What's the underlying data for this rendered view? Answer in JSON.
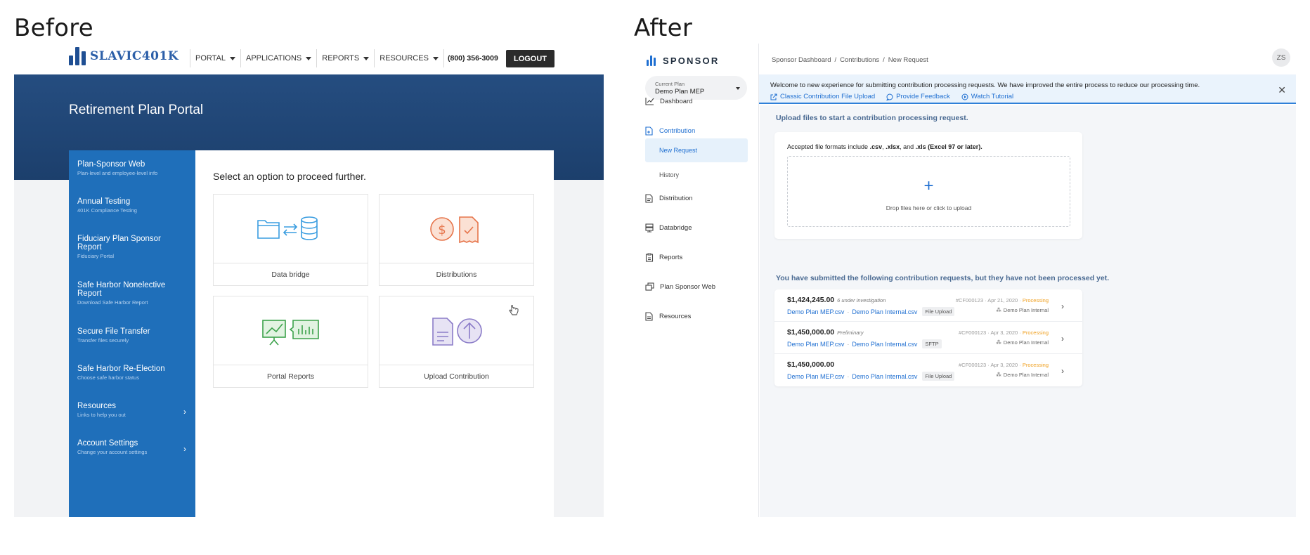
{
  "labels": {
    "before": "Before",
    "after": "After"
  },
  "before": {
    "logo": "SLAVIC401K",
    "nav": [
      "PORTAL",
      "APPLICATIONS",
      "REPORTS",
      "RESOURCES"
    ],
    "phone": "(800) 356-3009",
    "logout": "LOGOUT",
    "hero_title": "Retirement Plan Portal",
    "sidebar": [
      {
        "title": "Plan-Sponsor Web",
        "sub": "Plan-level and employee-level info"
      },
      {
        "title": "Annual Testing",
        "sub": "401K Compliance Testing"
      },
      {
        "title": "Fiduciary Plan Sponsor Report",
        "sub": "Fiduciary Portal"
      },
      {
        "title": "Safe Harbor Nonelective Report",
        "sub": "Download Safe Harbor Report"
      },
      {
        "title": "Secure File Transfer",
        "sub": "Transfer files securely"
      },
      {
        "title": "Safe Harbor Re-Election",
        "sub": "Choose safe harbor status"
      },
      {
        "title": "Resources",
        "sub": "Links to help you out"
      },
      {
        "title": "Account Settings",
        "sub": "Change your account settings"
      }
    ],
    "panel_title": "Select an option to proceed further.",
    "cards": [
      "Data bridge",
      "Distributions",
      "Portal Reports",
      "Upload Contribution"
    ],
    "colors": {
      "hero": "#1c3f6c",
      "sidebar": "#1f6fba",
      "logout": "#2b2b2b"
    }
  },
  "after": {
    "brand": "SPONSOR",
    "current_plan_label": "Current Plan",
    "current_plan_value": "Demo Plan MEP",
    "nav": {
      "dashboard": "Dashboard",
      "contribution": "Contribution",
      "new_request": "New Request",
      "history": "History",
      "distribution": "Distribution",
      "databridge": "Databridge",
      "reports": "Reports",
      "plan_sponsor_web": "Plan Sponsor Web",
      "resources": "Resources"
    },
    "breadcrumb": [
      "Sponsor Dashboard",
      "/",
      "Contributions",
      "/",
      "New Request"
    ],
    "avatar": "ZS",
    "banner_text": "Welcome to new experience for submitting contribution processing requests. We have improved the entire process to reduce our processing time.",
    "banner_links": [
      "Classic Contribution File Upload",
      "Provide Feedback",
      "Watch Tutorial"
    ],
    "upload_heading": "Upload files to start a contribution processing request.",
    "formats_prefix": "Accepted file formats include ",
    "formats_csv": ".csv",
    "formats_xlsx": ".xlsx",
    "formats_and": ", and ",
    "formats_xls": ".xls (Excel 97 or later).",
    "dropzone_plus": "+",
    "dropzone_text": "Drop files here or click to upload",
    "requests_heading": "You have submitted the following contribution requests, but they have not been processed yet.",
    "requests": [
      {
        "amount": "$1,424,245.00",
        "note": "6 under investigation",
        "file1": "Demo Plan MEP.csv",
        "file2": "Demo Plan Internal.csv",
        "tag": "File Upload",
        "meta": "#CF000123 · Apr 21, 2020 · ",
        "status": "Processing",
        "plan": "Demo Plan Internal"
      },
      {
        "amount": "$1,450,000.00",
        "note": "Preliminary",
        "file1": "Demo Plan MEP.csv",
        "file2": "Demo Plan Internal.csv",
        "tag": "SFTP",
        "meta": "#CF000123 · Apr 3, 2020 · ",
        "status": "Processing",
        "plan": "Demo Plan Internal"
      },
      {
        "amount": "$1,450,000.00",
        "note": "",
        "file1": "Demo Plan MEP.csv",
        "file2": "Demo Plan Internal.csv",
        "tag": "File Upload",
        "meta": "#CF000123 · Apr 3, 2020 · ",
        "status": "Processing",
        "plan": "Demo Plan Internal"
      }
    ],
    "colors": {
      "accent": "#1f6fd1",
      "processing": "#f0a020",
      "banner": "#eaf3fc"
    }
  }
}
